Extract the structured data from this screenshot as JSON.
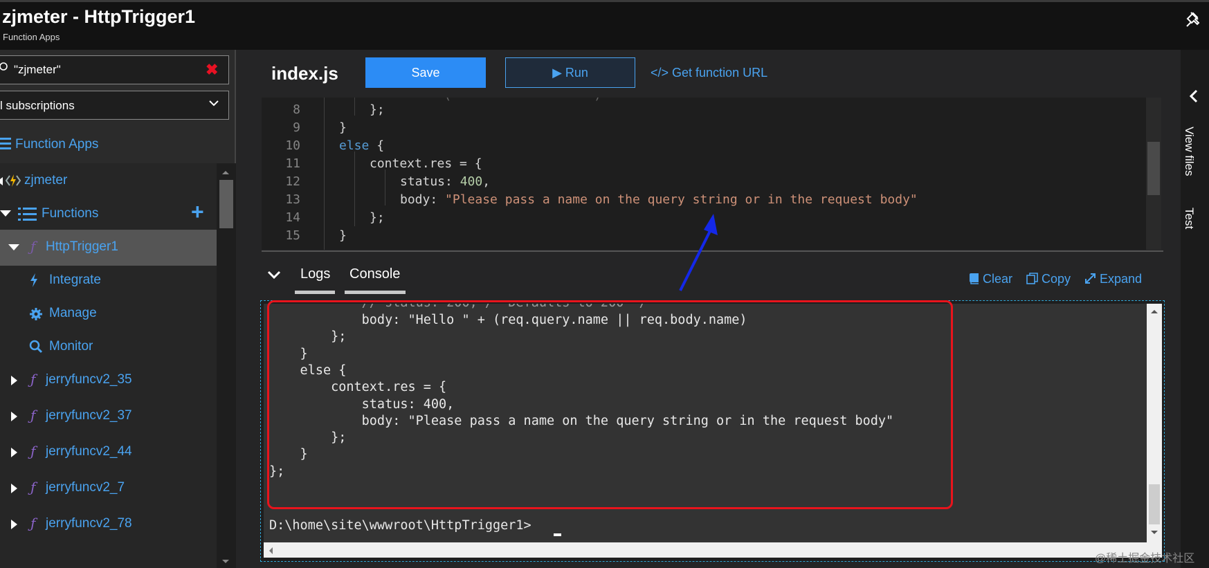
{
  "titlebar": {
    "title": "zjmeter - HttpTrigger1",
    "subtitle": "Function Apps",
    "pin_icon": "pin-icon"
  },
  "left": {
    "search_value": "\"zjmeter\"",
    "search_clear": "✖",
    "subscription_value": "l subscriptions",
    "function_apps_label": "Function Apps",
    "tree": {
      "app_name": "zjmeter",
      "functions_label": "Functions",
      "add_icon": "+",
      "selected_function": "HttpTrigger1",
      "sub_items": [
        {
          "label": "Integrate",
          "icon": "lightning-icon"
        },
        {
          "label": "Manage",
          "icon": "gear-icon"
        },
        {
          "label": "Monitor",
          "icon": "search-icon"
        }
      ],
      "other_functions": [
        "jerryfuncv2_35",
        "jerryfuncv2_37",
        "jerryfuncv2_44",
        "jerryfuncv2_7",
        "jerryfuncv2_78"
      ]
    }
  },
  "editor": {
    "file_name": "index.js",
    "save_label": "Save",
    "run_label": "▶ Run",
    "get_url_label": "</> Get function URL",
    "lines": [
      {
        "n": "8",
        "indent": 2,
        "parts": [
          {
            "t": "};",
            "c": ""
          }
        ]
      },
      {
        "n": "9",
        "indent": 1,
        "parts": [
          {
            "t": "}",
            "c": ""
          }
        ]
      },
      {
        "n": "10",
        "indent": 1,
        "parts": [
          {
            "t": "else",
            "c": "kw"
          },
          {
            "t": " {",
            "c": ""
          }
        ]
      },
      {
        "n": "11",
        "indent": 2,
        "parts": [
          {
            "t": "context.res = {",
            "c": ""
          }
        ]
      },
      {
        "n": "12",
        "indent": 3,
        "parts": [
          {
            "t": "status: ",
            "c": ""
          },
          {
            "t": "400",
            "c": "num"
          },
          {
            "t": ",",
            "c": ""
          }
        ]
      },
      {
        "n": "13",
        "indent": 3,
        "parts": [
          {
            "t": "body: ",
            "c": ""
          },
          {
            "t": "\"Please pass a name on the query string or in the request body\"",
            "c": "str"
          }
        ]
      },
      {
        "n": "14",
        "indent": 2,
        "parts": [
          {
            "t": "};",
            "c": ""
          }
        ]
      },
      {
        "n": "15",
        "indent": 1,
        "parts": [
          {
            "t": "}",
            "c": ""
          }
        ]
      }
    ]
  },
  "logs": {
    "tab_logs": "Logs",
    "tab_console": "Console",
    "clear_label": "Clear",
    "copy_label": "Copy",
    "expand_label": "Expand"
  },
  "console": {
    "lines": [
      "            body: \"Hello \" + (req.query.name || req.body.name)",
      "        };",
      "    }",
      "    else {",
      "        context.res = {",
      "            status: 400,",
      "            body: \"Please pass a name on the query string or in the request body\"",
      "        };",
      "    }",
      "};"
    ],
    "prompt": "D:\\home\\site\\wwwroot\\HttpTrigger1>"
  },
  "rightrail": {
    "view_files_label": "View files",
    "test_label": "Test"
  },
  "watermark": "@稀土掘金技术社区",
  "colors": {
    "accent": "#4aa3f0",
    "save_bg": "#2c8cf5",
    "highlight_border": "#e8141c",
    "arrow": "#1428e8"
  }
}
